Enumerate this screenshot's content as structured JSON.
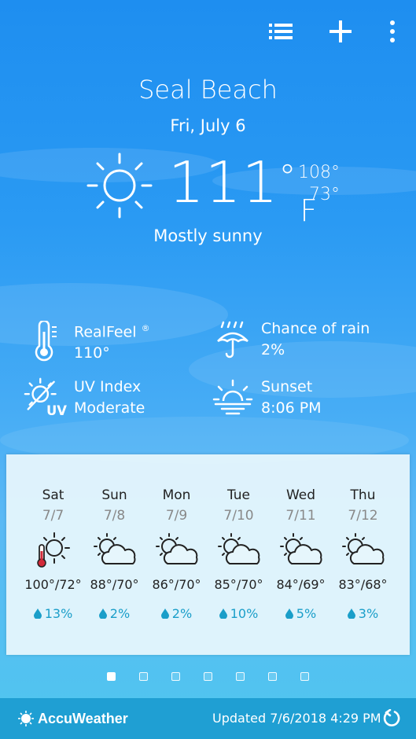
{
  "toolbar": {
    "list_icon": "list-icon",
    "add_icon": "plus-icon",
    "more_icon": "more-vertical-icon"
  },
  "location": {
    "city": "Seal Beach",
    "date": "Fri, July 6"
  },
  "current": {
    "icon": "sun-icon",
    "temp": "111",
    "deg": "°",
    "unit": "F",
    "high": "108°",
    "low": "73°",
    "condition": "Mostly sunny"
  },
  "details": {
    "realfeel": {
      "label": "RealFeel",
      "reg": "®",
      "value": "110°",
      "icon": "thermometer-icon"
    },
    "rain": {
      "label": "Chance of rain",
      "value": "2%",
      "icon": "umbrella-rain-icon"
    },
    "uv": {
      "label": "UV Index",
      "value": "Moderate",
      "icon": "uv-sun-icon"
    },
    "sunset": {
      "label": "Sunset",
      "value": "8:06 PM",
      "icon": "sunset-icon"
    }
  },
  "forecast": [
    {
      "day": "Sat",
      "date": "7/7",
      "temp": "100°/72°",
      "precip": "13%",
      "icon": "hot-sun-icon"
    },
    {
      "day": "Sun",
      "date": "7/8",
      "temp": "88°/70°",
      "precip": "2%",
      "icon": "partly-sunny-icon"
    },
    {
      "day": "Mon",
      "date": "7/9",
      "temp": "86°/70°",
      "precip": "2%",
      "icon": "partly-sunny-icon"
    },
    {
      "day": "Tue",
      "date": "7/10",
      "temp": "85°/70°",
      "precip": "10%",
      "icon": "partly-sunny-icon"
    },
    {
      "day": "Wed",
      "date": "7/11",
      "temp": "84°/69°",
      "precip": "5%",
      "icon": "partly-sunny-icon"
    },
    {
      "day": "Thu",
      "date": "7/12",
      "temp": "83°/68°",
      "precip": "3%",
      "icon": "partly-sunny-icon"
    }
  ],
  "pager": {
    "count": 7,
    "active": 0
  },
  "footer": {
    "brand": "AccuWeather",
    "updated": "Updated 7/6/2018 4:29 PM",
    "refresh_icon": "refresh-icon"
  },
  "colors": {
    "sky": "#2a9af3",
    "panel": "#e6f6fc",
    "precip": "#1a9ec9",
    "footer": "#1f9fd3"
  }
}
